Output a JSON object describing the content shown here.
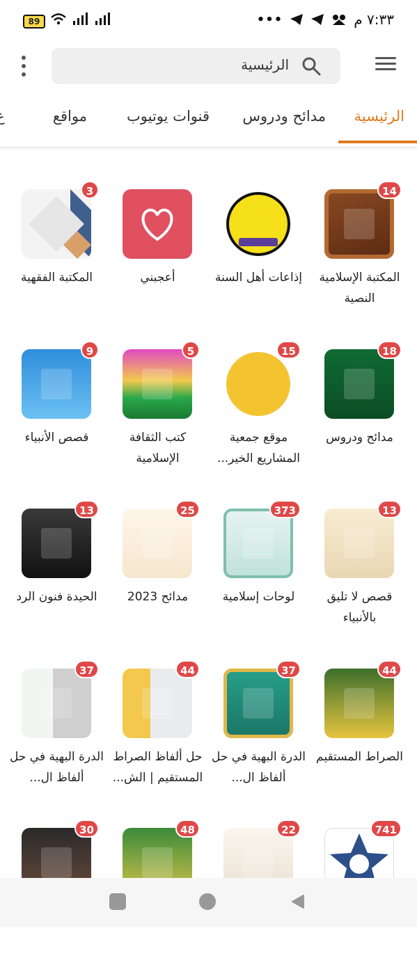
{
  "status": {
    "battery": "89",
    "time": "٧:٣٣ م",
    "dots": "•••"
  },
  "header": {
    "search_text": "الرئيسية"
  },
  "tabs": [
    {
      "label": "الرئيسية",
      "active": true
    },
    {
      "label": "مدائح ودروس"
    },
    {
      "label": "قنوات يوتيوب"
    },
    {
      "label": "مواقع"
    },
    {
      "label": "ع"
    }
  ],
  "grid": [
    {
      "label": "المكتبة الإسلامية النصية",
      "badge": "14",
      "icon": "book-cover-brown"
    },
    {
      "label": "إذاعات أهل السنة",
      "badge": "",
      "icon": "radio-logo-yellow"
    },
    {
      "label": "أعجبني",
      "badge": "",
      "icon": "heart-icon"
    },
    {
      "label": "المكتبة الفقهية",
      "badge": "3",
      "icon": "library-logo"
    },
    {
      "label": "مدائح ودروس",
      "badge": "18",
      "icon": "green-calligraphy"
    },
    {
      "label": "موقع جمعية المشاريع الخير...",
      "badge": "15",
      "icon": "mashari-logo"
    },
    {
      "label": "كتب الثقافة الإسلامية",
      "badge": "5",
      "icon": "mosque-image"
    },
    {
      "label": "قصص الأنبياء",
      "badge": "9",
      "icon": "prophets-stories"
    },
    {
      "label": "قصص لا تليق بالأنبياء",
      "badge": "13",
      "icon": "book-cover-cream"
    },
    {
      "label": "لوحات إسلامية",
      "badge": "373",
      "icon": "islamic-paintings"
    },
    {
      "label": "مدائح 2023",
      "badge": "25",
      "icon": "praise-2023"
    },
    {
      "label": "الحيدة فنون الرد",
      "badge": "13",
      "icon": "speaker-photo"
    },
    {
      "label": "الصراط المستقيم",
      "badge": "44",
      "icon": "book-yellow"
    },
    {
      "label": "الدرة البهية في حل ألفاظ ال...",
      "badge": "37",
      "icon": "book-teal"
    },
    {
      "label": "حل ألفاظ الصراط المستقيم | الش...",
      "badge": "44",
      "icon": "sheikh-book"
    },
    {
      "label": "الدرة البهية في حل ألفاظ ال...",
      "badge": "37",
      "icon": "sheikh-photo"
    },
    {
      "label": "",
      "badge": "741",
      "icon": "star-logo"
    },
    {
      "label": "",
      "badge": "22",
      "icon": "shamail-book"
    },
    {
      "label": "",
      "badge": "48",
      "icon": "green-book"
    },
    {
      "label": "",
      "badge": "30",
      "icon": "sheikh-turban"
    }
  ],
  "colors": {
    "accent": "#e07b1e",
    "badge": "#e04848"
  }
}
